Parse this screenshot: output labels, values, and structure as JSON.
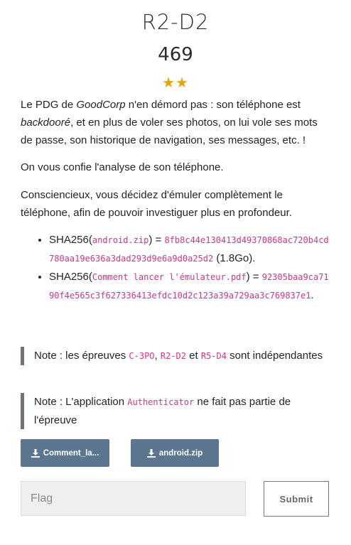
{
  "challenge": {
    "title": "R2-D2",
    "points": "469",
    "stars": "★★"
  },
  "description": {
    "p1": {
      "a": "Le PDG de ",
      "company": "GoodCorp",
      "b": " n'en démord pas : son téléphone est ",
      "backdoored": "backdooré",
      "c": ", et en plus de voler ses photos, on lui vole ses mots de passe, son historique de navigation, ses messages, etc. !"
    },
    "p2": "On vous confie l'analyse de son téléphone.",
    "p3": "Consciencieux, vous décidez d'émuler complètement le téléphone, afin de pouvoir investiguer plus en profondeur."
  },
  "hashes": [
    {
      "prefix": "SHA256(",
      "file": "android.zip",
      "mid": ") = ",
      "hash": "8fb8c44e130413d49370868ac720b4cd780aa19e636a3dad293d9e6a9d0a25d2",
      "suffix": " (1.8Go)."
    },
    {
      "prefix": "SHA256(",
      "file": "Comment lancer l'émulateur.pdf",
      "mid": ") = ",
      "hash": "92305baa9ca7190f4e565c3f627336413efdc10d2c123a39a729aa3c769837e1",
      "suffix": "."
    }
  ],
  "notes": {
    "n1": {
      "a": "Note : les épreuves ",
      "c1": "C-3PO",
      "sep1": ", ",
      "c2": "R2-D2",
      "sep2": " et ",
      "c3": "R5-D4",
      "b": " sont indépendantes"
    },
    "n2": {
      "a": "Note : L'application ",
      "app": "Authenticator",
      "b": " ne fait pas partie de l'épreuve"
    }
  },
  "downloads": {
    "file1": "Comment_la...",
    "file2": "android.zip",
    "icon": "download-icon"
  },
  "form": {
    "placeholder": "Flag",
    "submit": "Submit"
  },
  "colors": {
    "accent_button": "#5c7590",
    "code": "#d63384",
    "stars": "#e5a40a"
  }
}
